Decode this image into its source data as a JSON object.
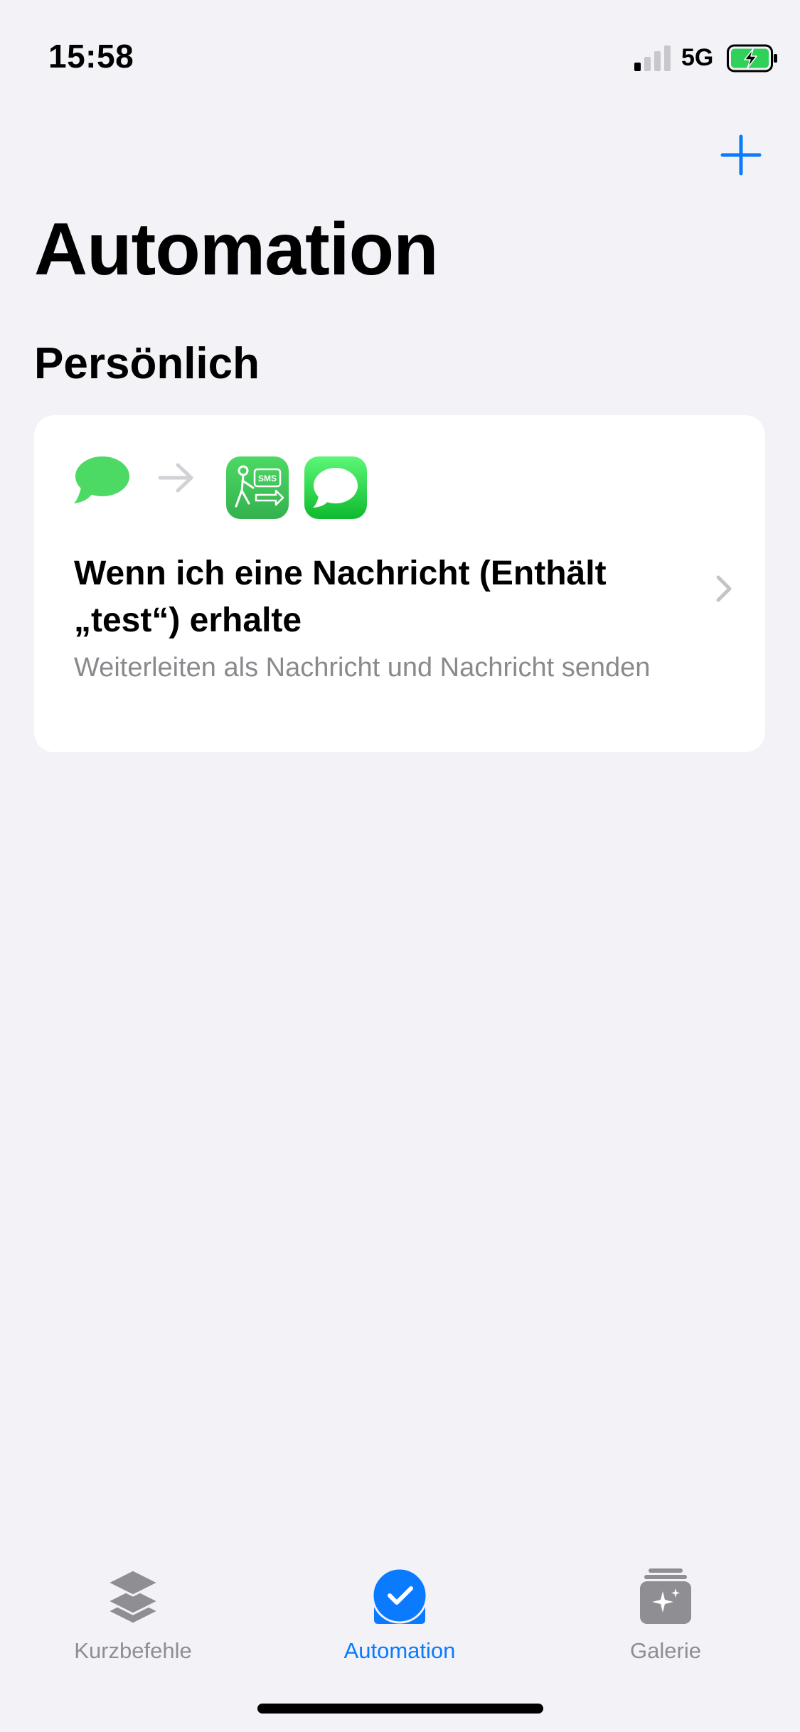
{
  "status_bar": {
    "time": "15:58",
    "network": "5G"
  },
  "header": {
    "title": "Automation",
    "add_icon": "plus-icon"
  },
  "section": {
    "title": "Persönlich"
  },
  "automation_card": {
    "title": "Wenn ich eine Nachricht (Enthält „test“) erhalte",
    "subtitle": "Weiterleiten als Nachricht und Nachricht senden",
    "icons": [
      "message-bubble-icon",
      "arrow-right-icon",
      "forward-sms-icon",
      "messages-app-icon"
    ],
    "badge_text": "SMS"
  },
  "tab_bar": {
    "tabs": [
      {
        "label": "Kurzbefehle",
        "icon": "layers-icon",
        "active": false
      },
      {
        "label": "Automation",
        "icon": "checkmark-clock-icon",
        "active": true
      },
      {
        "label": "Galerie",
        "icon": "sparkle-stack-icon",
        "active": false
      }
    ]
  },
  "colors": {
    "background": "#F2F2F7",
    "accent": "#0A7AFF",
    "messages_green": "#34C759",
    "inactive": "#8E8E93",
    "battery_green": "#30D158"
  }
}
